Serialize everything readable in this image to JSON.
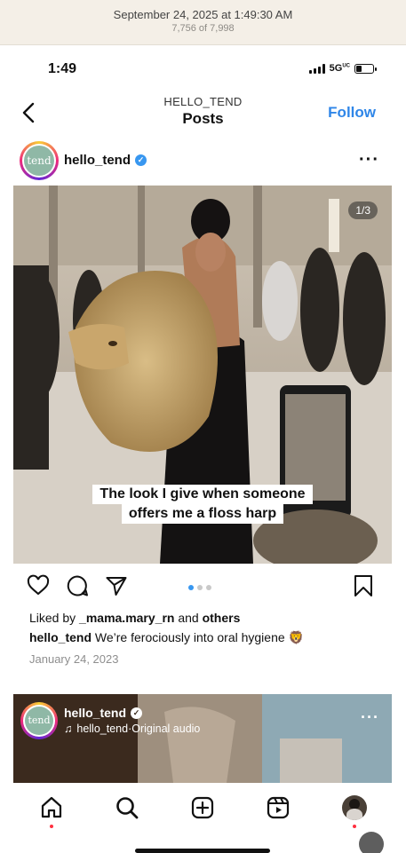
{
  "capture": {
    "timestamp": "September 24, 2025 at 1:49:30 AM",
    "count": "7,756 of 7,998"
  },
  "status": {
    "time": "1:49",
    "network": "5G",
    "network_sup": "UC",
    "battery_level": 0.35
  },
  "nav": {
    "subtitle": "HELLO_TEND",
    "title": "Posts",
    "follow_label": "Follow"
  },
  "post": {
    "username": "hello_tend",
    "avatar_text": "tend",
    "image_counter": "1/3",
    "overlay_caption": [
      "The look I give when someone",
      "offers me a floss harp"
    ],
    "likes_prefix": "Liked by ",
    "likes_user": "_mama.mary_rn",
    "likes_mid": " and ",
    "likes_others": "others",
    "caption_user": "hello_tend",
    "caption_text": " We’re ferociously into oral hygiene 🦁",
    "date": "January 24, 2023",
    "carousel_total": 3,
    "carousel_index": 0
  },
  "next_post": {
    "username": "hello_tend",
    "audio_user": "hello_tend",
    "audio_sep": " · ",
    "audio_label": "Original audio",
    "avatar_text": "tend"
  },
  "icons": {
    "status": [
      "signal-icon",
      "battery-icon"
    ],
    "nav": [
      "back-chevron-icon"
    ],
    "actions": [
      "heart-icon",
      "comment-icon",
      "share-icon",
      "bookmark-icon"
    ],
    "tabs": [
      "home-icon",
      "search-icon",
      "create-icon",
      "reels-icon",
      "profile-avatar"
    ]
  },
  "colors": {
    "accent": "#2f86e8",
    "verified": "#3897f0",
    "notification": "#ff3040",
    "avatar_bg": "#8fb8a6"
  }
}
